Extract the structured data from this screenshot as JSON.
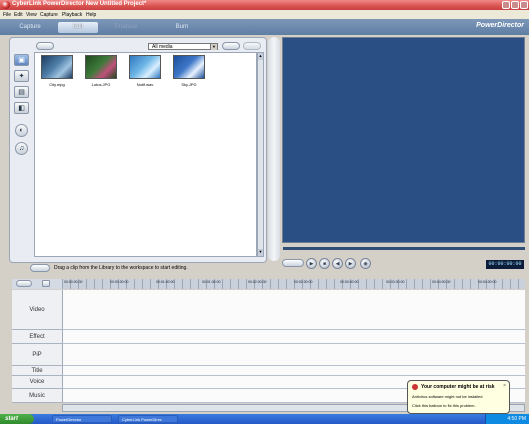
{
  "window": {
    "title": "CyberLink PowerDirector New Untitled Project*",
    "brand": "PowerDirector"
  },
  "menu": [
    "File",
    "Edit",
    "View",
    "Capture",
    "Playback",
    "Help"
  ],
  "modes": [
    {
      "label": "Capture",
      "state": "normal"
    },
    {
      "label": "Edit",
      "state": "active"
    },
    {
      "label": "Produce",
      "state": "disabled"
    },
    {
      "label": "Burn",
      "state": "normal"
    }
  ],
  "library": {
    "filter": "All media",
    "items": [
      {
        "name": "City.mpg",
        "colors": [
          "#4f7fa8",
          "#9fc3e0",
          "#1e3c63"
        ]
      },
      {
        "name": "Lotus.JPG",
        "colors": [
          "#3e7a3a",
          "#c0507a",
          "#214a20"
        ]
      },
      {
        "name": "Notif.wav",
        "colors": [
          "#6fb6e6",
          "#d8efff",
          "#2f78c0"
        ]
      },
      {
        "name": "Sky.JPG",
        "colors": [
          "#3f78c8",
          "#e8f2ff",
          "#1b4f9c"
        ]
      }
    ],
    "hint": "Drag a clip from the Library to the workspace to start editing."
  },
  "preview": {
    "time": "00:00:00:00",
    "colors": {
      "screen": "#2a4f85"
    }
  },
  "timeline": {
    "ruler_ticks": [
      "00:00:00:00",
      "00:00:30:00",
      "00:01:00:00",
      "00:01:30:00",
      "00:02:00:00",
      "00:02:30:00",
      "00:03:00:00",
      "00:03:30:00",
      "00:04:00:00",
      "00:04:30:00"
    ],
    "tracks": [
      "Video",
      "Effect",
      "PiP",
      "Title",
      "Voice",
      "Music"
    ]
  },
  "notification": {
    "title": "Your computer might be at risk",
    "line1": "Antivirus software might not be installed",
    "line2": "Click this balloon to fix this problem."
  },
  "taskbar": {
    "start": "start",
    "tasks": [
      "PowerDirector",
      "CyberLink PowerDirec"
    ],
    "clock": "4:50 PM"
  }
}
